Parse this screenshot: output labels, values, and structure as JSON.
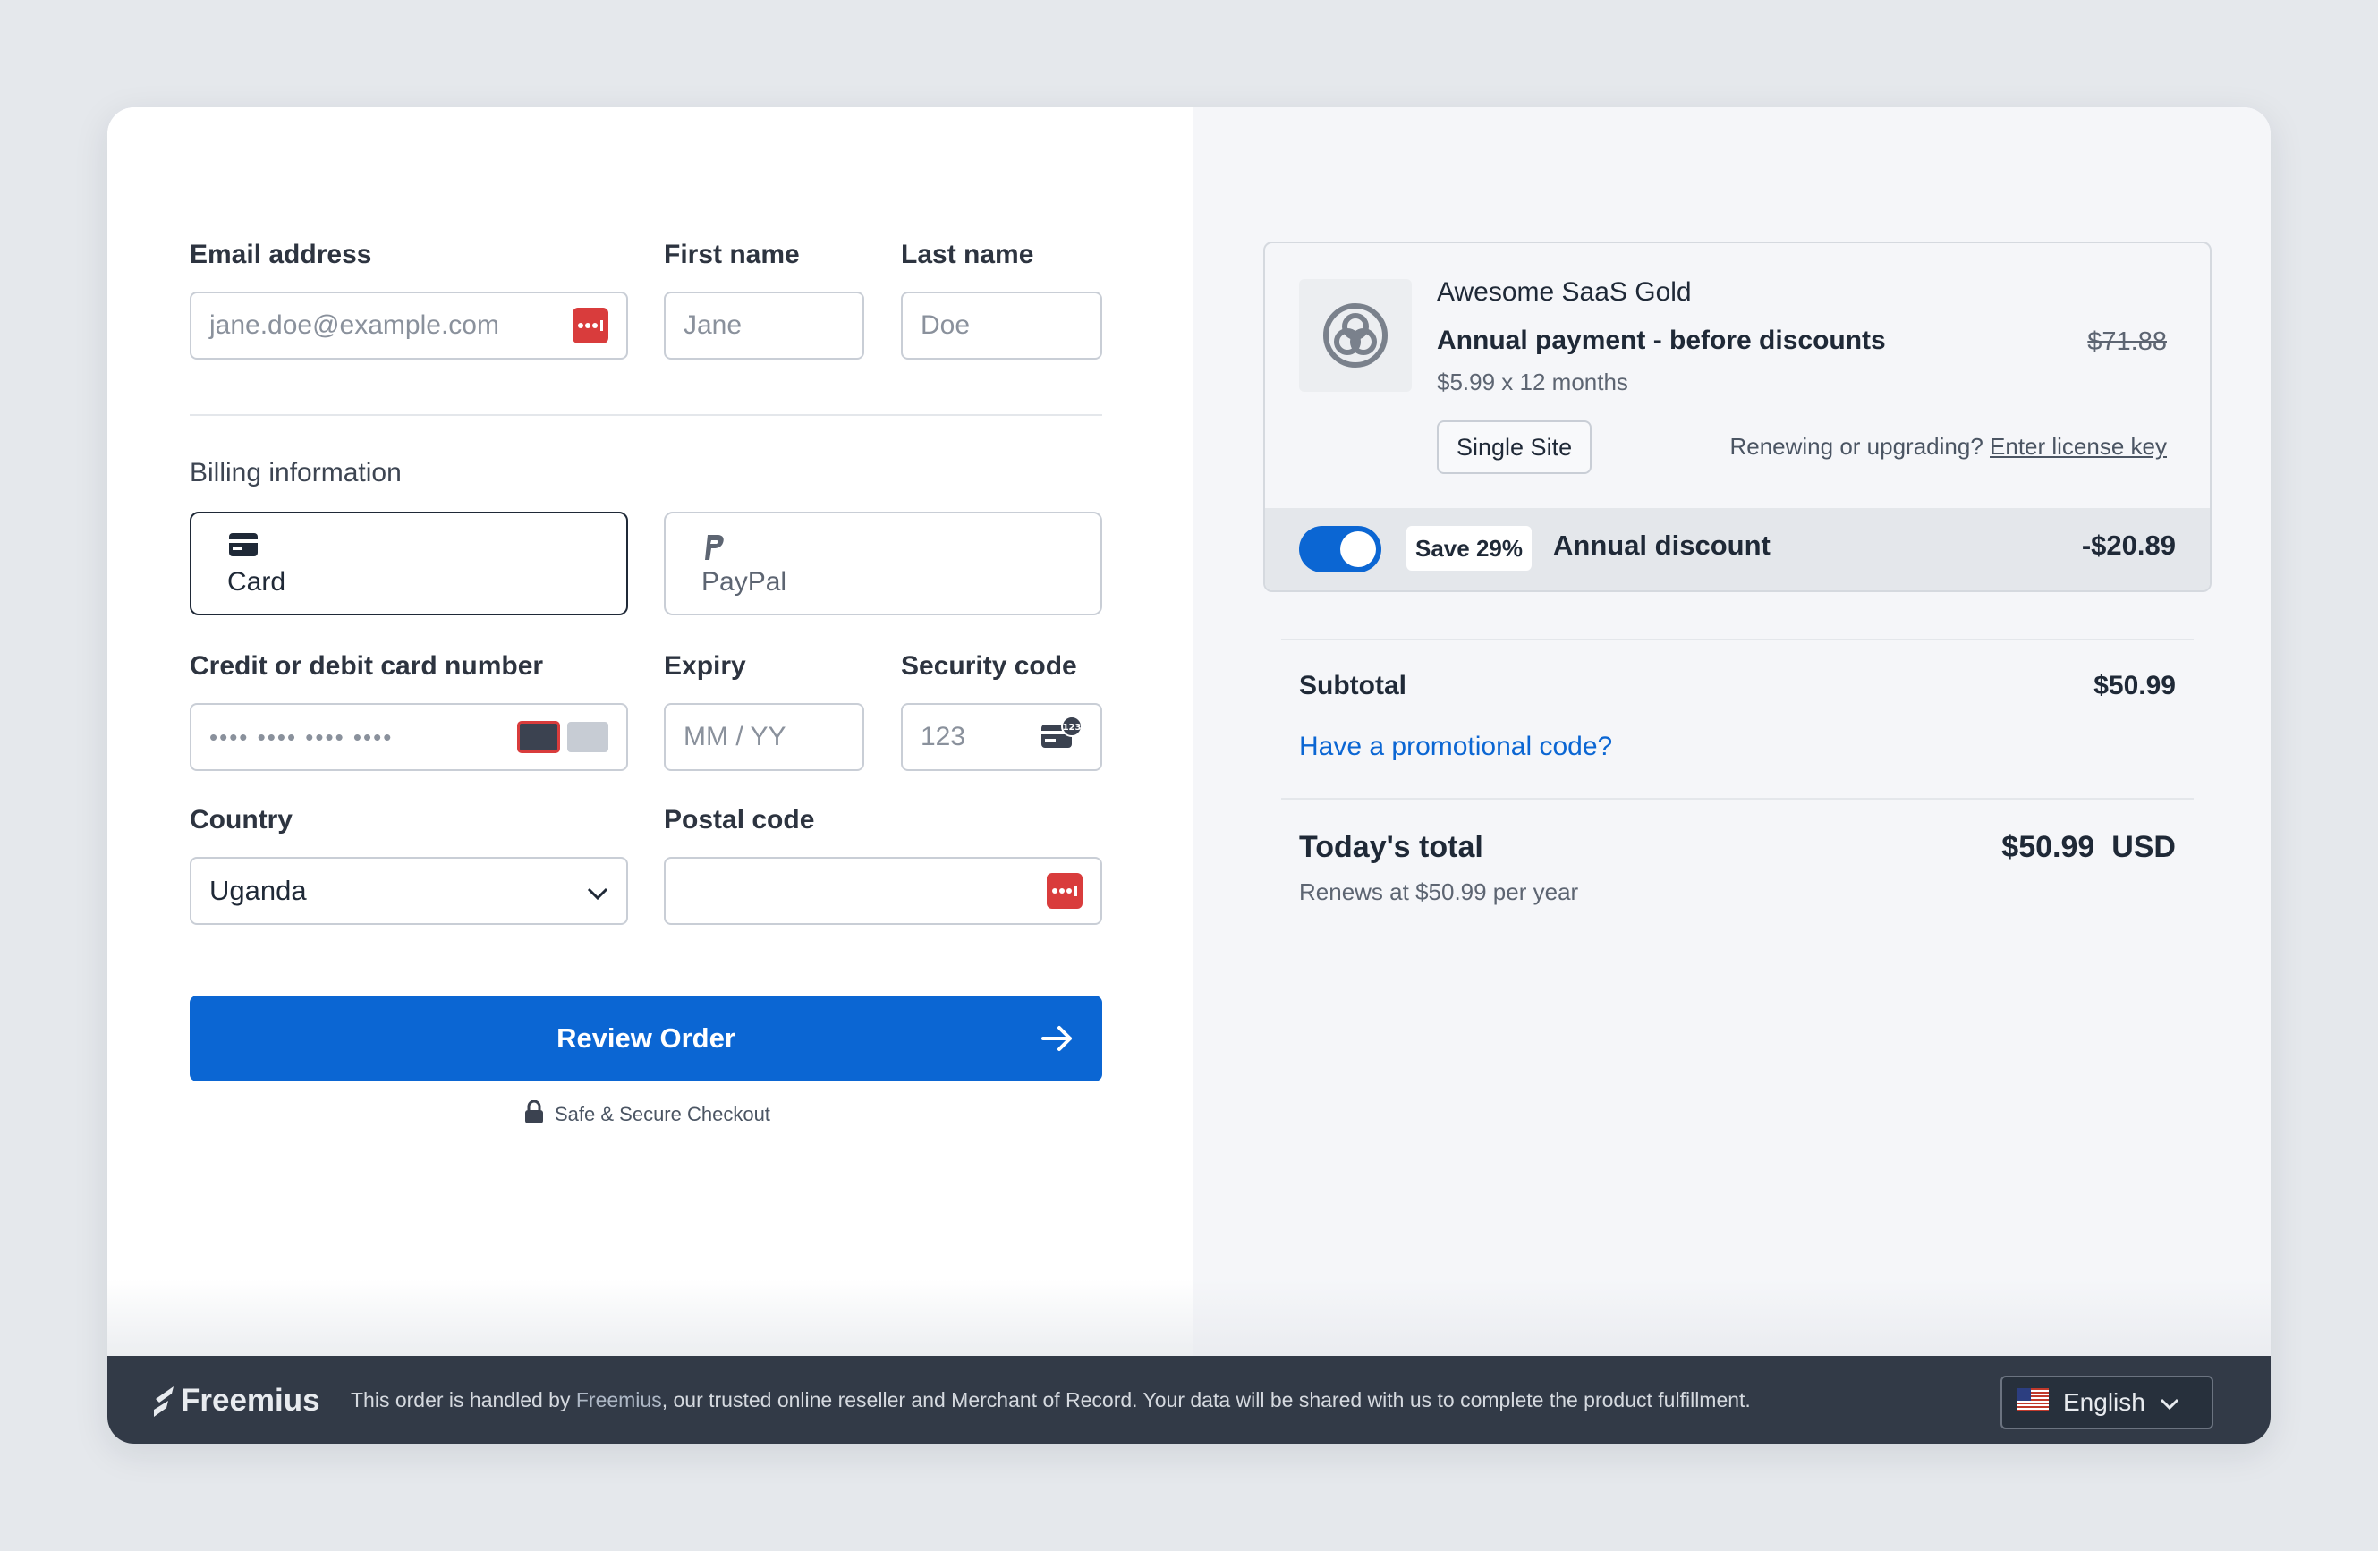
{
  "form": {
    "email": {
      "label": "Email address",
      "placeholder": "jane.doe@example.com"
    },
    "first_name": {
      "label": "First name",
      "placeholder": "Jane"
    },
    "last_name": {
      "label": "Last name",
      "placeholder": "Doe"
    },
    "billing_heading": "Billing information",
    "payment_methods": [
      {
        "label": "Card",
        "icon": "credit-card-icon",
        "selected": true
      },
      {
        "label": "PayPal",
        "icon": "paypal-icon",
        "selected": false
      }
    ],
    "card_number": {
      "label": "Credit or debit card number",
      "placeholder": "•••• •••• •••• ••••"
    },
    "expiry": {
      "label": "Expiry",
      "placeholder": "MM / YY"
    },
    "security_code": {
      "label": "Security code",
      "placeholder": "123"
    },
    "country": {
      "label": "Country",
      "value": "Uganda"
    },
    "postal_code": {
      "label": "Postal code",
      "value": ""
    },
    "submit_label": "Review Order",
    "secure_text": "Safe & Secure Checkout"
  },
  "summary": {
    "product_name": "Awesome SaaS Gold",
    "plan_title": "Annual payment - before discounts",
    "plan_detail": "$5.99 x 12 months",
    "original_price": "$71.88",
    "license_badge": "Single Site",
    "renew_text": "Renewing or upgrading?",
    "renew_link": "Enter license key",
    "discount": {
      "save_label": "Save 29%",
      "label": "Annual discount",
      "amount": "-$20.89",
      "enabled": true
    },
    "subtotal_label": "Subtotal",
    "subtotal_value": "$50.99",
    "promo_link": "Have a promotional code?",
    "total_label": "Today's total",
    "total_value": "$50.99",
    "total_currency": "USD",
    "renew_note": "Renews at $50.99 per year"
  },
  "footer": {
    "brand": "Freemius",
    "note_prefix": "This order is handled by ",
    "note_brand": "Freemius",
    "note_suffix": ", our trusted online reseller and Merchant of Record. Your data will be shared with us to complete the product fulfillment.",
    "language": "English"
  },
  "colors": {
    "accent": "#0b66d3",
    "danger": "#d93c3c",
    "footer_bg": "#323a47"
  }
}
